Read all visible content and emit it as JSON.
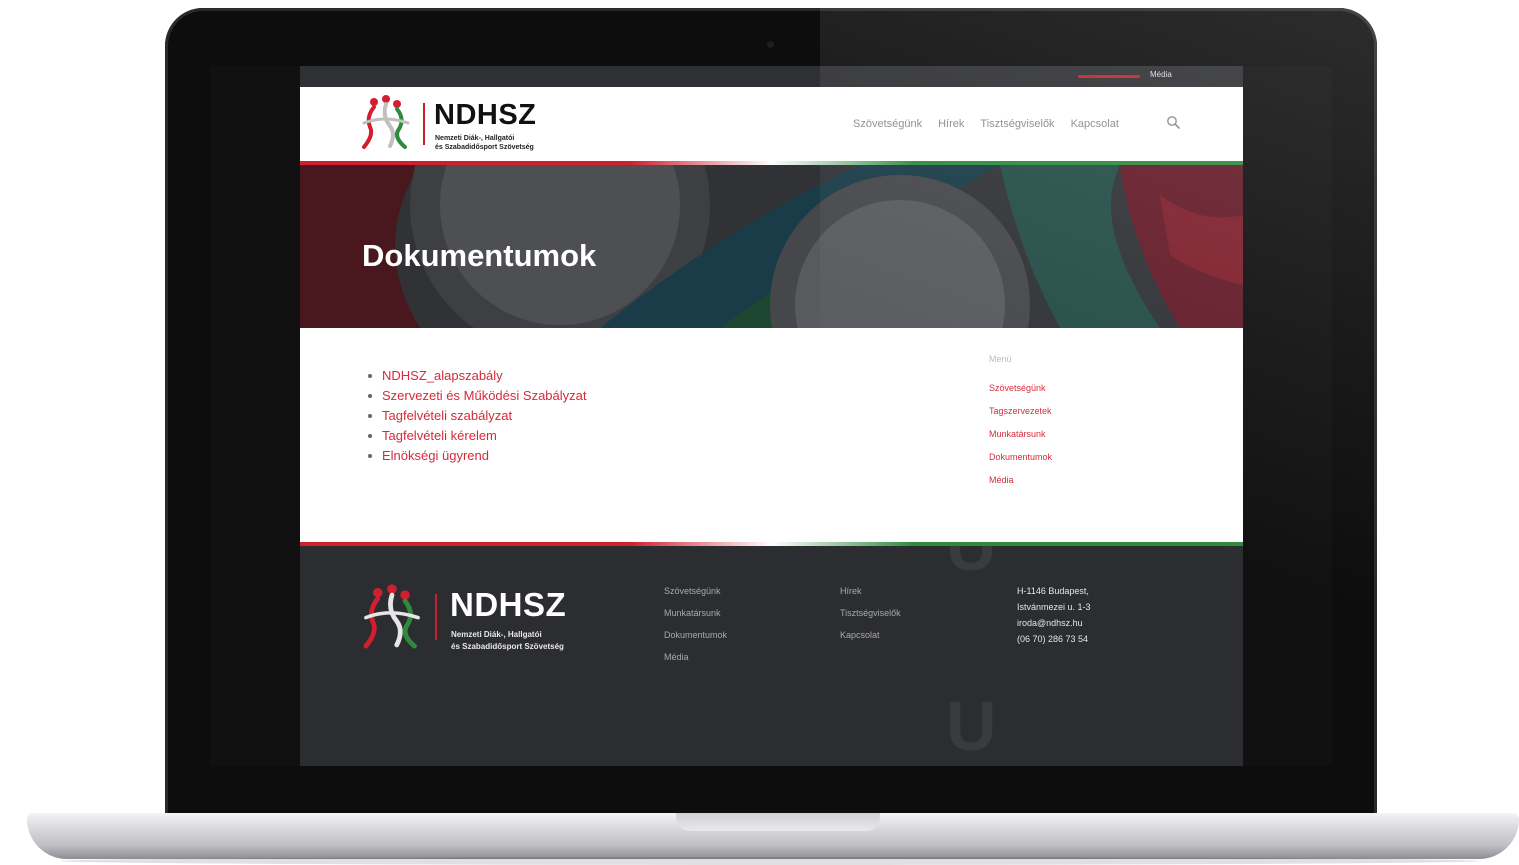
{
  "topbar": {
    "link": "Média"
  },
  "header": {
    "logo_title": "NDHSZ",
    "logo_sub_line1": "Nemzeti Diák-, Hallgatói",
    "logo_sub_line2": "és Szabadidősport Szövetség",
    "nav": [
      "Szövetségünk",
      "Hírek",
      "Tisztségviselők",
      "Kapcsolat"
    ]
  },
  "hero": {
    "title": "Dokumentumok"
  },
  "documents": [
    "NDHSZ_alapszabály",
    "Szervezeti és Működési Szabályzat",
    "Tagfelvételi szabályzat",
    "Tagfelvételi kérelem",
    "Elnökségi ügyrend"
  ],
  "sidebar": {
    "heading": "Menü",
    "items": [
      "Szövetségünk",
      "Tagszervezetek",
      "Munkatársunk",
      "Dokumentumok",
      "Média"
    ]
  },
  "footer": {
    "logo_title": "NDHSZ",
    "logo_sub_line1": "Nemzeti Diák-, Hallgatói",
    "logo_sub_line2": "és Szabadidősport Szövetség",
    "col1": [
      "Szövetségünk",
      "Munkatársunk",
      "Dokumentumok",
      "Média"
    ],
    "col2": [
      "Hírek",
      "Tisztségviselők",
      "Kapcsolat"
    ],
    "contact": [
      "H-1146 Budapest,",
      "Istvánmezei u. 1-3",
      "iroda@ndhsz.hu",
      "(06 70) 286 73 54"
    ]
  },
  "colors": {
    "accent_red": "#d62a3a",
    "accent_green": "#2e8b3e",
    "footer_bg": "#2c2d30"
  },
  "icons": {
    "search": "search-icon",
    "logo": "logo-mark-icon"
  }
}
